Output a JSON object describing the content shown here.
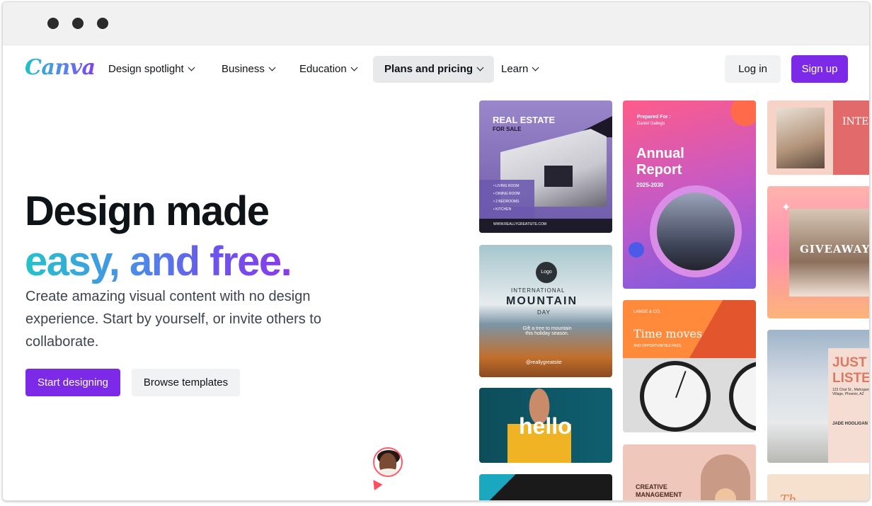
{
  "nav": {
    "logo": "Canva",
    "items": [
      {
        "label": "Design spotlight"
      },
      {
        "label": "Business"
      },
      {
        "label": "Education"
      },
      {
        "label": "Plans and pricing"
      },
      {
        "label": "Learn"
      }
    ],
    "login_label": "Log in",
    "signup_label": "Sign up"
  },
  "hero": {
    "title_line1": "Design made",
    "title_line2": "easy, and free.",
    "subtitle": "Create amazing visual content with no design experience. Start by yourself, or invite others to collaborate.",
    "start_label": "Start designing",
    "browse_label": "Browse templates"
  },
  "templates": {
    "real_estate": {
      "title": "REAL ESTATE",
      "subtitle": "FOR SALE",
      "features": [
        "• LIVING ROOM",
        "• DINING ROOM",
        "• 2 BEDROOMS",
        "• KITCHEN"
      ],
      "footer": "WWW.REALLYGREATSITE.COM"
    },
    "annual_report": {
      "prepared": "Prepared For :",
      "name": "Daniel Gallego",
      "title": "Annual Report",
      "years": "2025-2030"
    },
    "interior": {
      "title": "INTER DESIG"
    },
    "mountain": {
      "logo": "Logo",
      "line1": "INTERNATIONAL",
      "line2": "MOUNTAIN",
      "line3": "DAY",
      "body": "Gift a tree to mountain this holiday season.",
      "handle": "@reallygreatsite"
    },
    "time_moves": {
      "brand": "LANGE & CO.",
      "title": "Time moves",
      "tagline": "AND OPPORTUNITIES PASS."
    },
    "giveaway": {
      "title": "GIVEAWAY"
    },
    "hello": {
      "title": "hello"
    },
    "just_listed": {
      "title": "JUST LISTE",
      "address": "123 Chat St., Mahogany Village, Phoenix, AZ",
      "agent": "JADE HOOLIGAN"
    },
    "creative": {
      "title": "CREATIVE MANAGEMENT"
    }
  },
  "colors": {
    "accent": "#7d2ae8",
    "gradient_start": "#24c3c9",
    "gradient_end": "#8a3bea"
  }
}
